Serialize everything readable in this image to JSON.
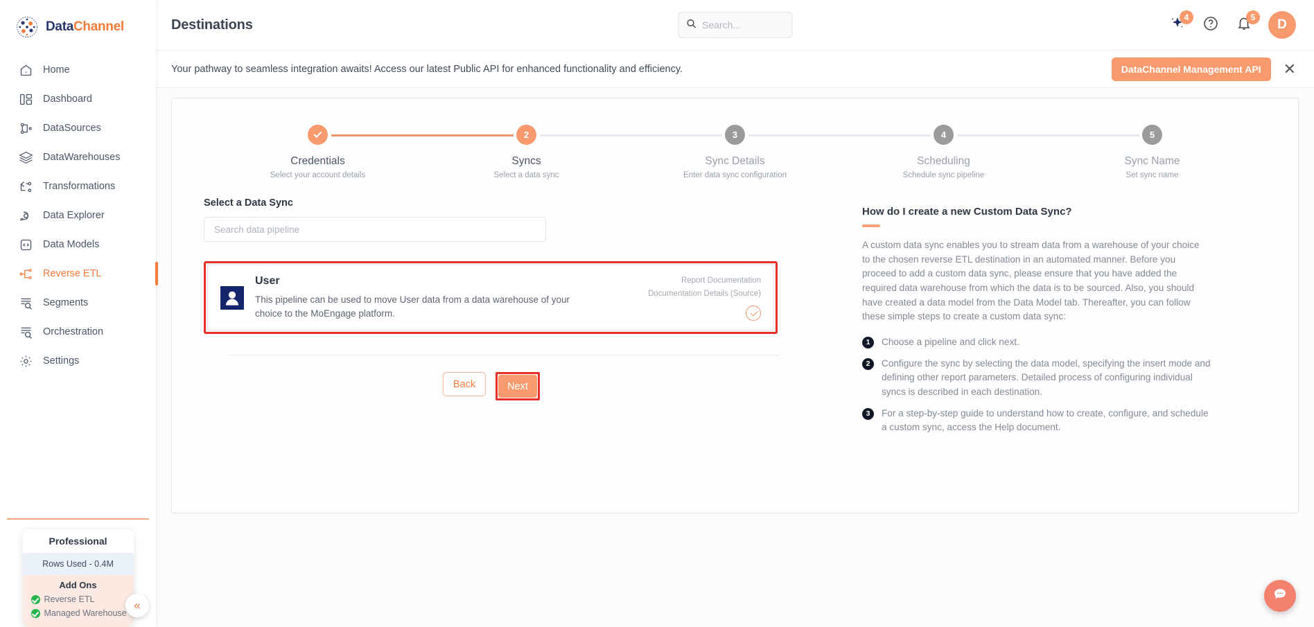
{
  "brand": {
    "name_part1": "Data",
    "name_part2": "Channel"
  },
  "sidebar": {
    "items": [
      {
        "label": "Home",
        "icon": "home-icon"
      },
      {
        "label": "Dashboard",
        "icon": "dashboard-icon"
      },
      {
        "label": "DataSources",
        "icon": "datasources-icon"
      },
      {
        "label": "DataWarehouses",
        "icon": "datawarehouses-icon"
      },
      {
        "label": "Transformations",
        "icon": "transformations-icon"
      },
      {
        "label": "Data Explorer",
        "icon": "data-explorer-icon"
      },
      {
        "label": "Data Models",
        "icon": "data-models-icon"
      },
      {
        "label": "Reverse ETL",
        "icon": "reverse-etl-icon"
      },
      {
        "label": "Segments",
        "icon": "segments-icon"
      },
      {
        "label": "Orchestration",
        "icon": "orchestration-icon"
      },
      {
        "label": "Settings",
        "icon": "settings-icon"
      }
    ],
    "active_item": "Reverse ETL",
    "plan": {
      "title": "Professional",
      "rows_used": "Rows Used - 0.4M",
      "addons_title": "Add Ons",
      "addons": [
        "Reverse ETL",
        "Managed Warehouse"
      ]
    },
    "collapse_label": "«"
  },
  "header": {
    "title": "Destinations",
    "search": {
      "placeholder": "Search...",
      "value": ""
    },
    "sparkle_badge": "4",
    "notification_badge": "5",
    "avatar_initial": "D"
  },
  "banner": {
    "text": "Your pathway to seamless integration awaits! Access our latest Public API for enhanced functionality and efficiency.",
    "button_label": "DataChannel Management API",
    "close_label": "✕"
  },
  "stepper": {
    "steps": [
      {
        "num": "1",
        "label": "Credentials",
        "sub": "Select your account details",
        "state": "done"
      },
      {
        "num": "2",
        "label": "Syncs",
        "sub": "Select a data sync",
        "state": "current"
      },
      {
        "num": "3",
        "label": "Sync Details",
        "sub": "Enter data sync configuration",
        "state": "todo"
      },
      {
        "num": "4",
        "label": "Scheduling",
        "sub": "Schedule sync pipeline",
        "state": "todo"
      },
      {
        "num": "5",
        "label": "Sync Name",
        "sub": "Set sync name",
        "state": "todo"
      }
    ]
  },
  "main": {
    "section_label": "Select a Data Sync",
    "pipeline_search": {
      "placeholder": "Search data pipeline",
      "value": ""
    },
    "pipeline": {
      "title": "User",
      "description": "This pipeline can be used to move User data from a data warehouse of your choice to the MoEngage platform.",
      "doc_line1": "Report Documentation",
      "doc_line2": "Documentation Details (Source)",
      "selected": true
    },
    "back_label": "Back",
    "next_label": "Next"
  },
  "help": {
    "title": "How do I create a new Custom Data Sync?",
    "body": "A custom data sync enables you to stream data from a warehouse of your choice to the chosen reverse ETL destination in an automated manner. Before you proceed to add a custom data sync, please ensure that you have added the required data warehouse from which the data is to be sourced. Also, you should have created a data model from the Data Model tab. Thereafter, you can follow these simple steps to create a custom data sync:",
    "steps": [
      {
        "num": "1",
        "text": "Choose a pipeline and click next."
      },
      {
        "num": "2",
        "text": "Configure the sync by selecting the data model, specifying the insert mode and defining other report parameters. Detailed process of configuring individual syncs is described in each destination."
      },
      {
        "num": "3",
        "text": "For a step-by-step guide to understand how to create, configure, and schedule a custom sync, access the Help document."
      }
    ]
  },
  "colors": {
    "accent": "#f47b39",
    "accent_light": "#f89a6e",
    "brand_navy": "#28356a",
    "highlight_red": "#e8302a",
    "step_todo": "#9b9b9b",
    "success_green": "#25b34b"
  }
}
